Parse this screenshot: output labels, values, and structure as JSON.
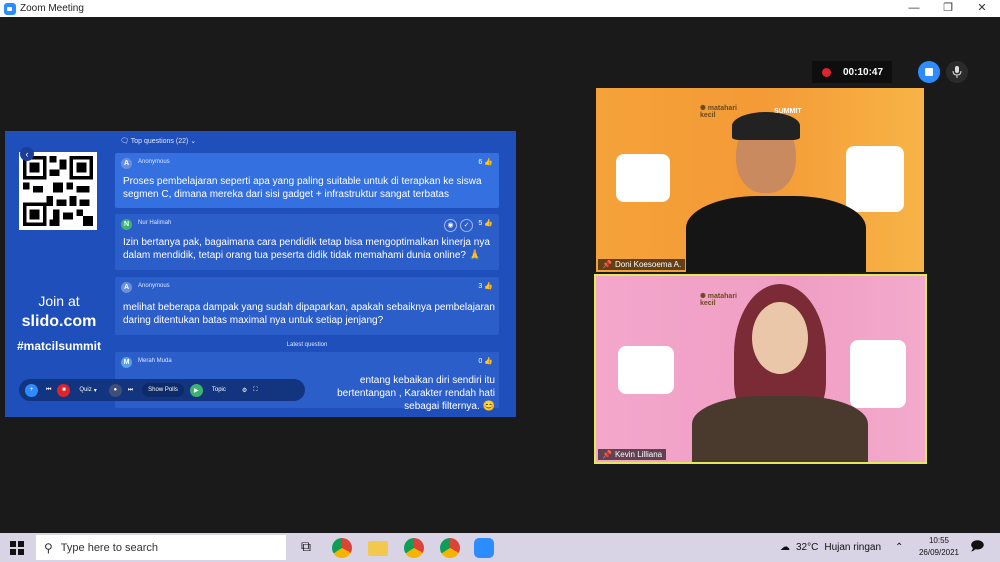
{
  "window": {
    "title": "Zoom Meeting",
    "controls": [
      "—",
      "❐",
      "✕"
    ]
  },
  "recording": {
    "time": "00:10:47"
  },
  "slido": {
    "join_label": "Join at",
    "site": "slido.com",
    "hashtag": "#matcilsummit",
    "top_questions_label": "Top questions (22)",
    "latest_label": "Latest question",
    "questions": [
      {
        "initial": "A",
        "author": "Anonymous",
        "votes": "6",
        "text": "Proses pembelajaran seperti apa yang paling suitable untuk di terapkan ke siswa segmen C, dimana mereka dari sisi gadget + infrastruktur sangat terbatas",
        "avatar_color": "#6b8fe0"
      },
      {
        "initial": "N",
        "author": "Nur Halimah",
        "votes": "5",
        "text": "Izin bertanya pak, bagaimana cara pendidik tetap bisa mengoptimalkan kinerja nya dalam mendidik, tetapi orang tua peserta didik tidak memahami dunia online? 🙏",
        "avatar_color": "#3cb371"
      },
      {
        "initial": "A",
        "author": "Anonymous",
        "votes": "3",
        "text": "melihat beberapa dampak yang sudah dipaparkan, apakah sebaiknya pembelajaran daring ditentukan batas maximal nya untuk setiap jenjang?",
        "avatar_color": "#6b8fe0"
      },
      {
        "initial": "M",
        "author": "Merah Muda",
        "votes": "0",
        "text": "entang kebaikan diri sendiri itu bertentangan , Karakter rendah hati sebagai filternya. 😊",
        "avatar_color": "#5aa0e8"
      }
    ],
    "controls": {
      "quiz": "Quiz",
      "show_polls": "Show Polls",
      "topic": "Topic"
    }
  },
  "participants": [
    {
      "name": "Doni Koesoema A."
    },
    {
      "name": "Kevin Lilliana"
    }
  ],
  "taskbar": {
    "search_placeholder": "Type here to search",
    "temperature": "32°C",
    "weather": "Hujan ringan",
    "time": "10:55",
    "date": "26/09/2021"
  }
}
